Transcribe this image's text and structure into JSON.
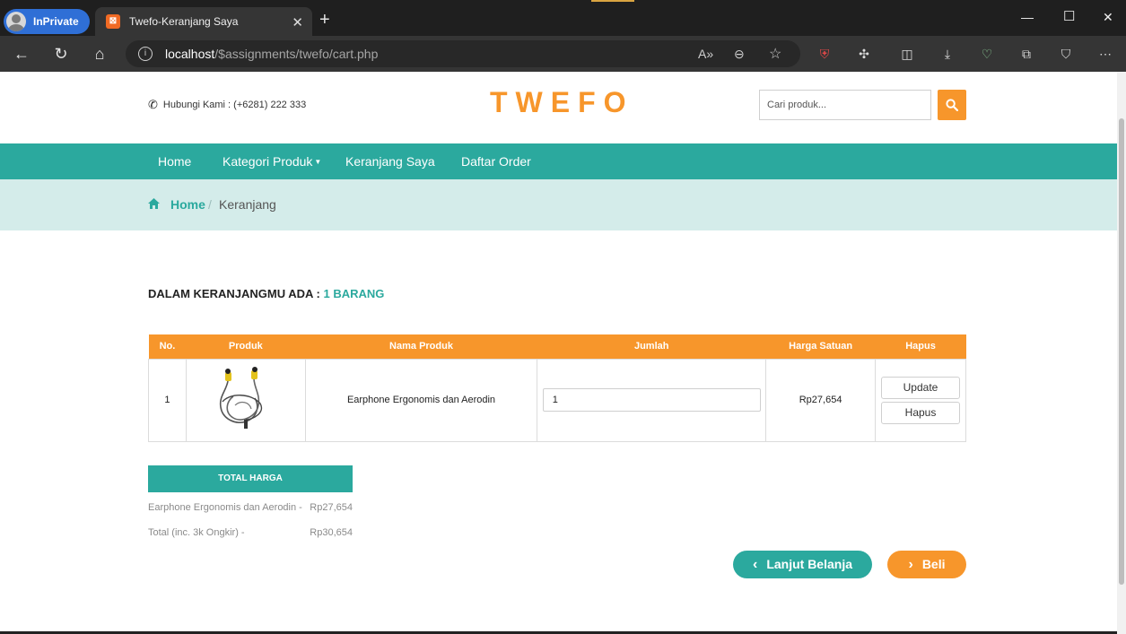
{
  "browser": {
    "inprivate_label": "InPrivate",
    "tab_title": "Twefo-Keranjang Saya",
    "url_host": "localhost",
    "url_path": "/$assignments/twefo/cart.php"
  },
  "header": {
    "contact": "Hubungi Kami : (+6281) 222 333",
    "logo": "TWEFO",
    "search_placeholder": "Cari produk..."
  },
  "nav": {
    "home": "Home",
    "kategori": "Kategori Produk",
    "keranjang": "Keranjang Saya",
    "order": "Daftar Order"
  },
  "breadcrumb": {
    "home": "Home",
    "separator": "/",
    "current": "Keranjang"
  },
  "cart": {
    "title_prefix": "DALAM KERANJANGMU ADA : ",
    "count_text": "1 BARANG",
    "columns": [
      "No.",
      "Produk",
      "Nama Produk",
      "Jumlah",
      "Harga Satuan",
      "Hapus"
    ],
    "rows": [
      {
        "no": "1",
        "name": "Earphone Ergonomis dan Aerodin",
        "qty": "1",
        "price": "Rp27,654",
        "update_label": "Update",
        "delete_label": "Hapus"
      }
    ]
  },
  "summary": {
    "heading": "TOTAL HARGA",
    "item_label": "Earphone Ergonomis dan Aerodin -",
    "item_value": "Rp27,654",
    "total_label": "Total (inc. 3k Ongkir) -",
    "total_value": "Rp30,654"
  },
  "actions": {
    "continue_label": "Lanjut Belanja",
    "buy_label": "Beli"
  },
  "colors": {
    "accent_teal": "#2ba99e",
    "accent_orange": "#f7962b"
  }
}
